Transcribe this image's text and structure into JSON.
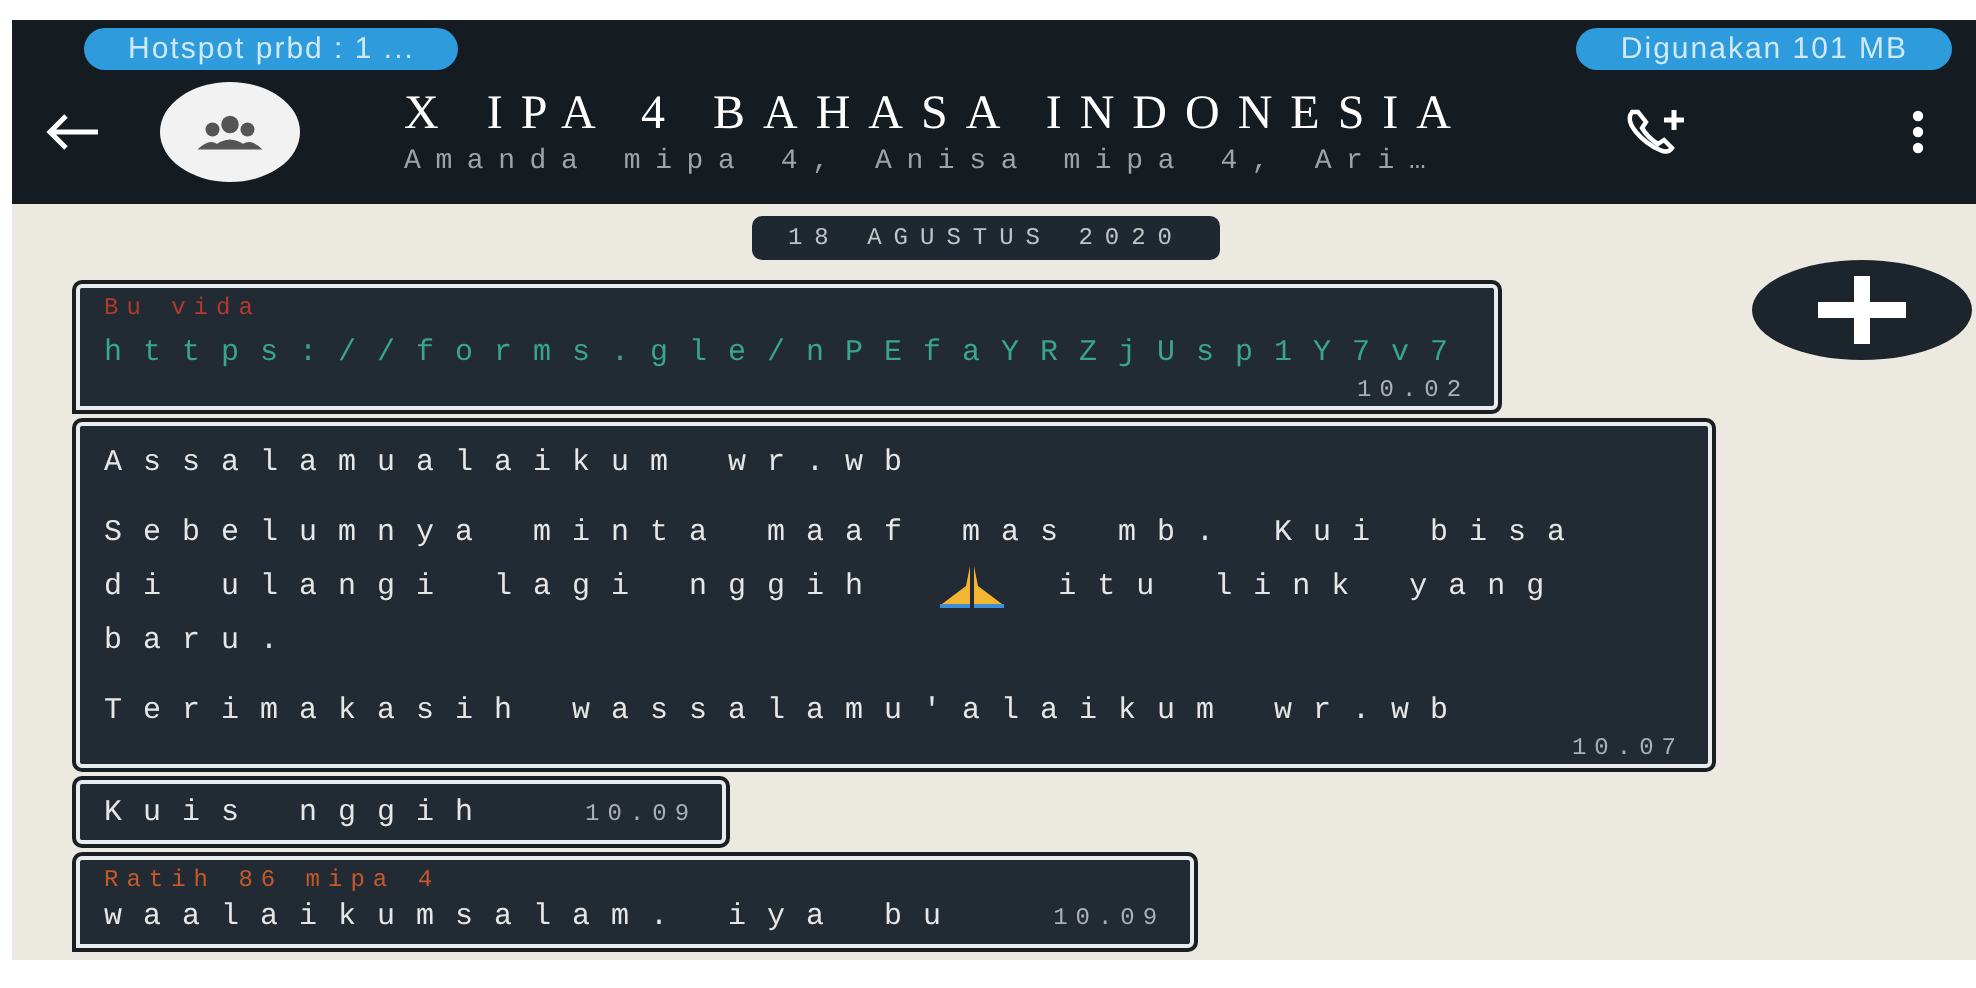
{
  "status_bar": {
    "hotspot": "Hotspot prbd : 1 ...",
    "data_usage": "Digunakan 101 MB"
  },
  "header": {
    "title": "X IPA 4 BAHASA INDONESIA",
    "subtitle": "Amanda mipa 4, Anisa mipa 4, Ari…"
  },
  "date_chip": "18 AGUSTUS 2020",
  "messages": [
    {
      "sender": "Bu vida",
      "color": "#b23a2c",
      "paragraphs": [
        [
          {
            "kind": "link",
            "text": "https://forms.gle/nPEfaYRZjUsp1Y7v7"
          }
        ]
      ],
      "time": "10.02",
      "tail": true
    },
    {
      "paragraphs": [
        [
          {
            "kind": "text",
            "text": "Assalamualaikum wr.wb"
          }
        ],
        [
          {
            "kind": "text",
            "text": "Sebelumnya minta maaf mas mb. Kui bisa"
          },
          {
            "kind": "text",
            "text": "di ulangi lagi nggih"
          },
          {
            "kind": "emoji"
          },
          {
            "kind": "text",
            "text": "itu link yang"
          },
          {
            "kind": "text",
            "text": "baru."
          }
        ],
        [
          {
            "kind": "text",
            "text": "Terimakasih wassalamu'alaikum wr.wb"
          }
        ]
      ],
      "time": "10.07",
      "tail": false
    },
    {
      "paragraphs": [
        [
          {
            "kind": "text",
            "text": "Kuis nggih"
          }
        ]
      ],
      "time": "10.09",
      "tail": false,
      "inline_time": true
    },
    {
      "sender": "Ratih 86 mipa 4",
      "color": "#c4592c",
      "paragraphs": [
        [
          {
            "kind": "text",
            "text": "waalaikumsalam. iya bu"
          }
        ]
      ],
      "time": "10.09",
      "tail": true,
      "inline_time": true
    }
  ]
}
